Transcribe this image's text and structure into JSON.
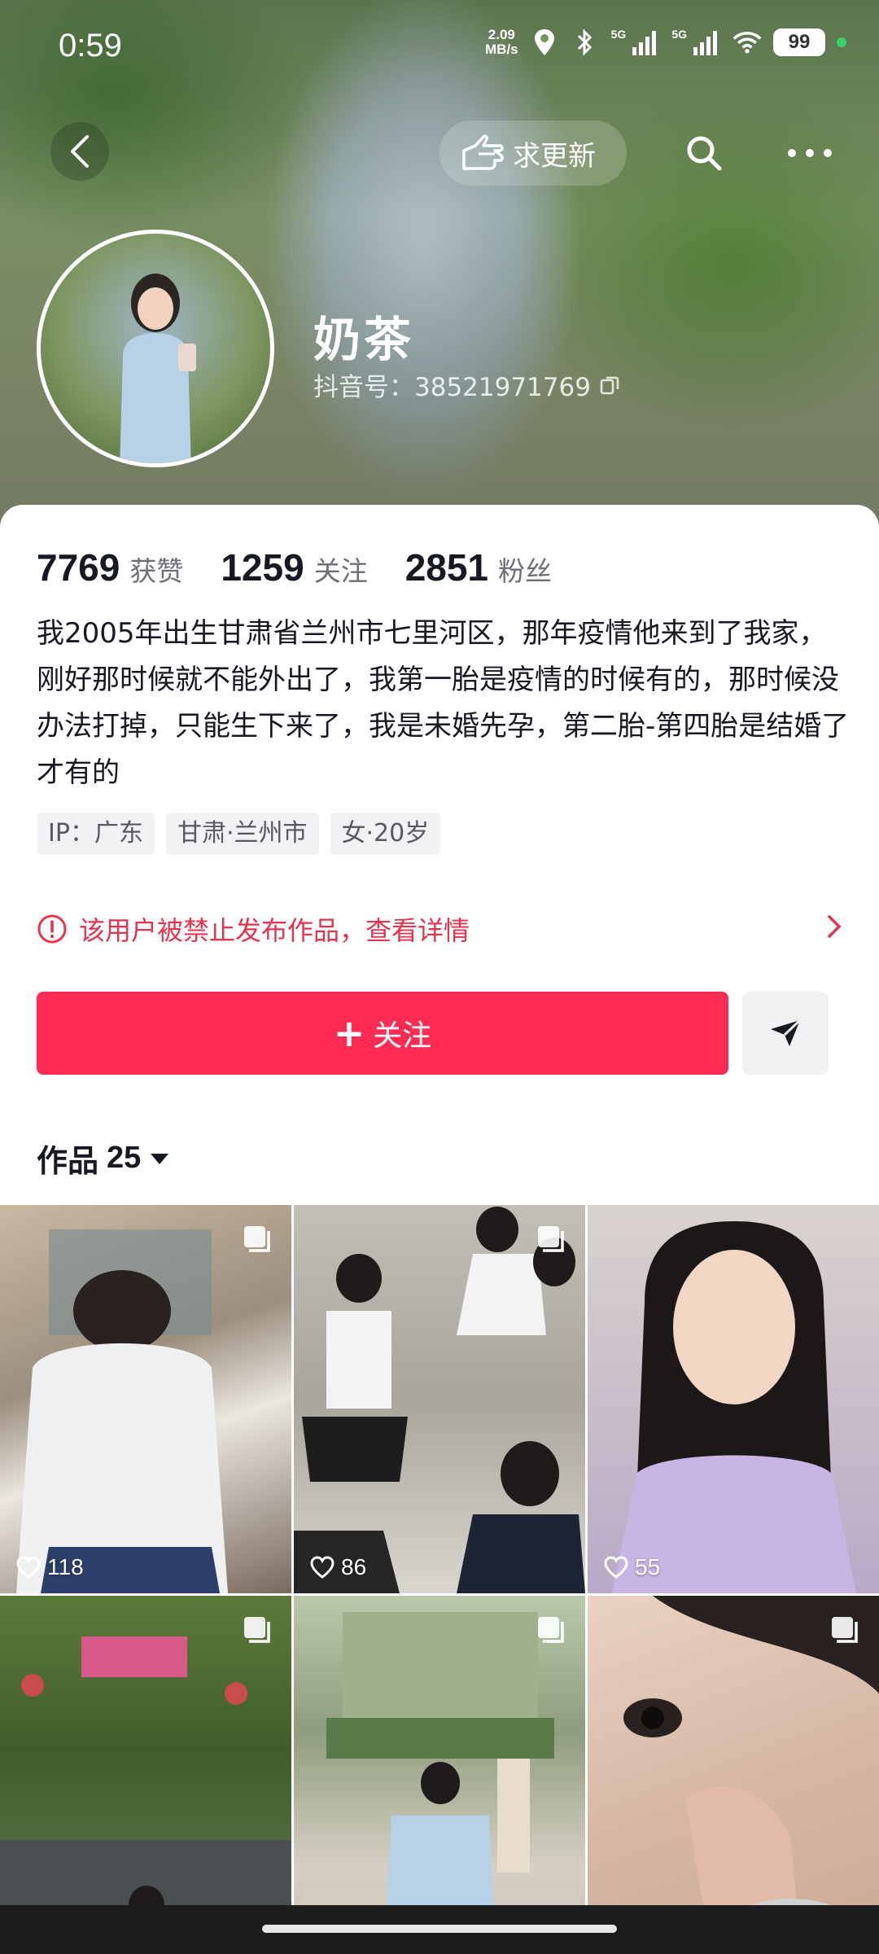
{
  "status_bar": {
    "time": "0:59",
    "net_speed": "2.09",
    "net_unit": "MB/s",
    "sim1": "5G",
    "sim2": "5G",
    "battery": "99"
  },
  "nav": {
    "update_label": "求更新"
  },
  "profile": {
    "name": "奶茶",
    "douyin_id": "抖音号：38521971769"
  },
  "stats": [
    {
      "value": "7769",
      "label": "获赞"
    },
    {
      "value": "1259",
      "label": "关注"
    },
    {
      "value": "2851",
      "label": "粉丝"
    }
  ],
  "bio": "我2005年出生甘肃省兰州市七里河区，那年疫情他来到了我家，刚好那时候就不能外出了，我第一胎是疫情的时候有的，那时候没办法打掉，只能生下来了，我是未婚先孕，第二胎-第四胎是结婚了才有的",
  "tags": [
    "IP：广东",
    "甘肃·兰州市",
    "女·20岁"
  ],
  "ban_notice": "该用户被禁止发布作品，查看详情",
  "follow_button": {
    "plus": "+",
    "label": "关注"
  },
  "works": {
    "label": "作品",
    "count": "25"
  },
  "tiles": [
    {
      "likes": "118",
      "multi": true
    },
    {
      "likes": "86",
      "multi": true
    },
    {
      "likes": "55",
      "multi": false
    },
    {
      "likes": "",
      "multi": true
    },
    {
      "likes": "",
      "multi": true
    },
    {
      "likes": "",
      "multi": true
    }
  ],
  "colors": {
    "accent": "#fe2c55",
    "warning": "#e6344f"
  }
}
